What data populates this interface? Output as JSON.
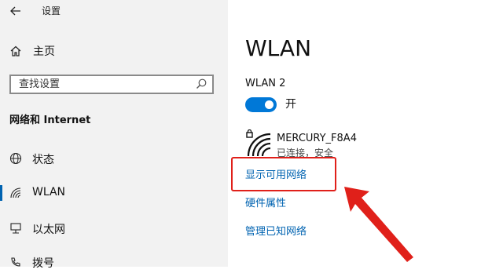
{
  "window": {
    "title": "设置",
    "back_icon": "back-arrow-icon"
  },
  "sidebar": {
    "home_label": "主页",
    "search_placeholder": "查找设置",
    "section_title": "网络和 Internet",
    "items": [
      {
        "label": "状态",
        "icon": "globe-icon",
        "active": false
      },
      {
        "label": "WLAN",
        "icon": "wifi-signal-icon",
        "active": true
      },
      {
        "label": "以太网",
        "icon": "ethernet-icon",
        "active": false
      },
      {
        "label": "拨号",
        "icon": "dialup-phone-icon",
        "active": false
      }
    ]
  },
  "main": {
    "title": "WLAN",
    "adapter_name": "WLAN 2",
    "toggle_state_label": "开",
    "toggle_on": true,
    "network": {
      "ssid": "MERCURY_F8A4",
      "status": "已连接，安全",
      "icon": "secured-wifi-icon"
    },
    "links": [
      "显示可用网络",
      "硬件属性",
      "管理已知网络"
    ]
  },
  "annotation": {
    "highlight_color": "#e0201a",
    "target_link_index": 0
  },
  "colors": {
    "accent": "#0078d7",
    "link": "#0063b1",
    "sidebar_bg": "#f2f2f2",
    "annotation_red": "#e0201a"
  }
}
